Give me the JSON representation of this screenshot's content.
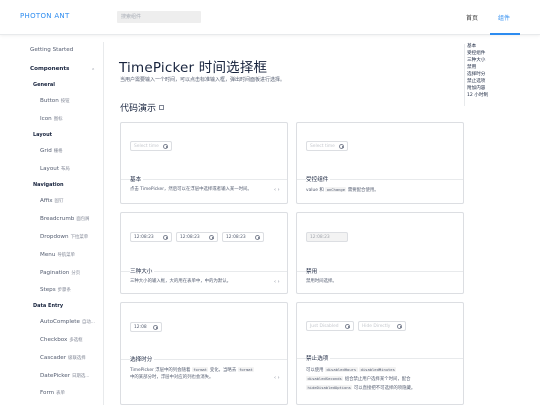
{
  "header": {
    "logo": "PHOTON ANT",
    "search_placeholder": "搜索组件",
    "nav": [
      {
        "label": "首页"
      },
      {
        "label": "组件"
      }
    ]
  },
  "sidebar": {
    "getting_started": "Getting Started",
    "components": "Components",
    "groups": [
      {
        "title": "General",
        "items": [
          {
            "en": "Button",
            "cn": "按钮"
          },
          {
            "en": "Icon",
            "cn": "图标"
          }
        ]
      },
      {
        "title": "Layout",
        "items": [
          {
            "en": "Grid",
            "cn": "栅格"
          },
          {
            "en": "Layout",
            "cn": "布局"
          }
        ]
      },
      {
        "title": "Navigation",
        "items": [
          {
            "en": "Affix",
            "cn": "固钉"
          },
          {
            "en": "Breadcrumb",
            "cn": "面包屑"
          },
          {
            "en": "Dropdown",
            "cn": "下拉菜单"
          },
          {
            "en": "Menu",
            "cn": "导航菜单"
          },
          {
            "en": "Pagination",
            "cn": "分页"
          },
          {
            "en": "Steps",
            "cn": "步骤条"
          }
        ]
      },
      {
        "title": "Data Entry",
        "items": [
          {
            "en": "AutoComplete",
            "cn": "自动..."
          },
          {
            "en": "Checkbox",
            "cn": "多选框"
          },
          {
            "en": "Cascader",
            "cn": "级联选择"
          },
          {
            "en": "DatePicker",
            "cn": "日期选..."
          },
          {
            "en": "Form",
            "cn": "表单"
          }
        ]
      }
    ]
  },
  "main": {
    "title": "TimePicker 时间选择框",
    "description": "当用户需要输入一个时间，可以点击标准输入框，弹出时间面板进行选择。",
    "demo_title": "代码演示",
    "cards": {
      "basic": {
        "placeholder": "Select time",
        "title": "基本",
        "desc": "点击 TimePicker，然后可以在浮层中选择或者输入某一时间。"
      },
      "controlled": {
        "placeholder": "Select time",
        "title": "受控组件",
        "desc_pre": "value 和 ",
        "desc_code": "onChange",
        "desc_post": " 需要配合使用。"
      },
      "sizes": {
        "values": [
          "12:08:23",
          "12:08:23",
          "12:08:23"
        ],
        "title": "三种大小",
        "desc": "三种大小的输入框，大的用在表单中，中的为默认。"
      },
      "disabled": {
        "value": "12:08:23",
        "title": "禁用",
        "desc": "禁用时间选择。"
      },
      "format": {
        "value": "12:08",
        "title": "选择时分",
        "desc_1": "TimePicker 浮层中的列会随着 ",
        "code_1": "format",
        "desc_2": " 变化，当略去 ",
        "code_2": "format",
        "desc_3": " 中的某部分时，浮层中对应的列也会消失。"
      },
      "disabled_options": {
        "placeholders": [
          "Just Disabled",
          "Hide Directly"
        ],
        "title": "禁止选项",
        "line1_pre": "可以使用 ",
        "code_a": "disabledHours",
        "code_b": "disabledMinutes",
        "code_c": "disabledSeconds",
        "line2_mid": " 组合禁止用户选择某个时间，配合 ",
        "code_d": "hideDisabledOptions",
        "line3_post": " 可以直接把不可选择的项隐藏。"
      }
    },
    "code_toggle": "‹ ›"
  },
  "anchors": [
    "基本",
    "受控组件",
    "三种大小",
    "禁用",
    "选择时分",
    "禁止选项",
    "附加内容",
    "12 小时制"
  ],
  "colors": {
    "primary": "#2d8cf0",
    "border": "#dcdee2"
  }
}
